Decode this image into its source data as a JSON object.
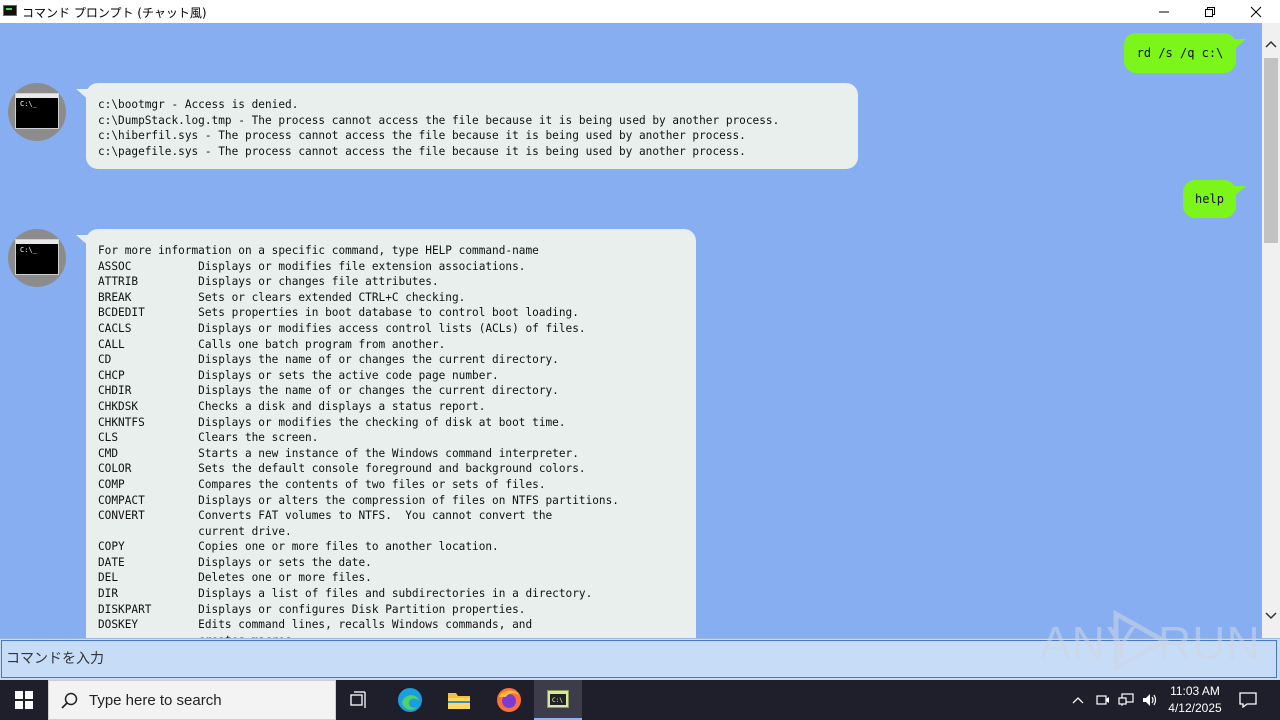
{
  "window": {
    "title": "コマンド プロンプト (チャット風)"
  },
  "chat": {
    "messages": [
      {
        "role": "user",
        "text": "rd /s /q c:\\"
      },
      {
        "role": "bot",
        "avatar_prompt": "C:\\_",
        "text": "c:\\bootmgr - Access is denied.\nc:\\DumpStack.log.tmp - The process cannot access the file because it is being used by another process.\nc:\\hiberfil.sys - The process cannot access the file because it is being used by another process.\nc:\\pagefile.sys - The process cannot access the file because it is being used by another process."
      },
      {
        "role": "user",
        "text": "help"
      },
      {
        "role": "bot",
        "avatar_prompt": "C:\\_",
        "text": "For more information on a specific command, type HELP command-name\nASSOC          Displays or modifies file extension associations.\nATTRIB         Displays or changes file attributes.\nBREAK          Sets or clears extended CTRL+C checking.\nBCDEDIT        Sets properties in boot database to control boot loading.\nCACLS          Displays or modifies access control lists (ACLs) of files.\nCALL           Calls one batch program from another.\nCD             Displays the name of or changes the current directory.\nCHCP           Displays or sets the active code page number.\nCHDIR          Displays the name of or changes the current directory.\nCHKDSK         Checks a disk and displays a status report.\nCHKNTFS        Displays or modifies the checking of disk at boot time.\nCLS            Clears the screen.\nCMD            Starts a new instance of the Windows command interpreter.\nCOLOR          Sets the default console foreground and background colors.\nCOMP           Compares the contents of two files or sets of files.\nCOMPACT        Displays or alters the compression of files on NTFS partitions.\nCONVERT        Converts FAT volumes to NTFS.  You cannot convert the\n               current drive.\nCOPY           Copies one or more files to another location.\nDATE           Displays or sets the date.\nDEL            Deletes one or more files.\nDIR            Displays a list of files and subdirectories in a directory.\nDISKPART       Displays or configures Disk Partition properties.\nDOSKEY         Edits command lines, recalls Windows commands, and\n               creates macros."
      }
    ]
  },
  "input": {
    "placeholder": "コマンドを入力"
  },
  "watermark": {
    "left": "ANY",
    "right": "RUN"
  },
  "taskbar": {
    "search_placeholder": "Type here to search",
    "time": "11:03 AM",
    "date": "4/12/2025"
  },
  "colors": {
    "chat_background": "#86aef0",
    "bot_bubble": "#e8efed",
    "user_bubble": "#7cf51a",
    "input_bar": "#c7dcf7",
    "taskbar": "#1f1f2b"
  },
  "icons": {
    "window_controls": [
      "minimize-icon",
      "restore-icon",
      "close-icon"
    ],
    "taskbar": [
      "windows-start-icon",
      "search-icon",
      "task-view-icon",
      "edge-icon",
      "file-explorer-icon",
      "firefox-icon",
      "chat-cmd-app-icon"
    ],
    "tray": [
      "chevron-up-icon",
      "meet-now-icon",
      "network-icon",
      "volume-icon",
      "notification-icon"
    ]
  }
}
